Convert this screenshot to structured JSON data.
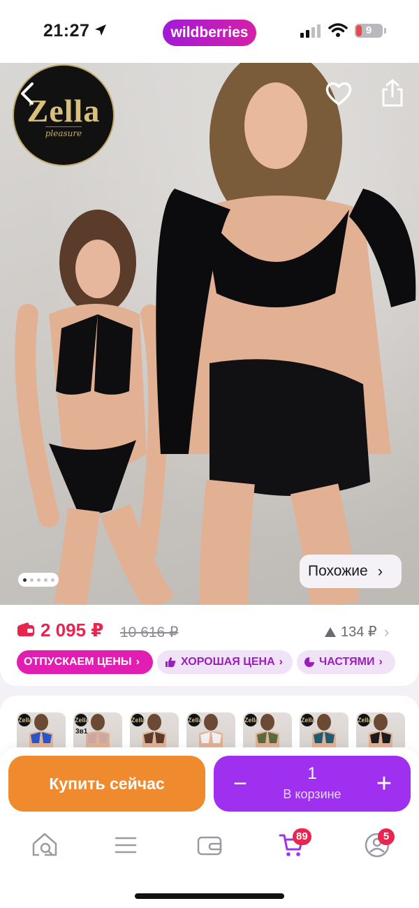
{
  "status_bar": {
    "time": "21:27",
    "brand": "wildberries",
    "battery": "9"
  },
  "hero": {
    "logo_name": "Zella",
    "logo_sub": "pleasure",
    "similar_label": "Похожие",
    "similar_chevron": "›",
    "gallery_dots": 5,
    "gallery_active": 1
  },
  "price": {
    "current": "2 095 ₽",
    "old": "10 616 ₽",
    "delta": "134 ₽",
    "delta_chevron": "›"
  },
  "tags": {
    "release": "ОТПУСКАЕМ ЦЕНЫ",
    "good": "ХОРОШАЯ ЦЕНА",
    "parts": "ЧАСТЯМИ",
    "chevron": "›"
  },
  "variants": [
    {
      "badge": "Zella",
      "color": "#2b56c8"
    },
    {
      "badge": "Zella",
      "color": "#c9a9a6",
      "note": "3в1"
    },
    {
      "badge": "Zella",
      "color": "#5a3a2a"
    },
    {
      "badge": "Zella",
      "color": "#f0eeee"
    },
    {
      "badge": "Zella",
      "color": "#5b6a3d"
    },
    {
      "badge": "Zella",
      "color": "#1f5c73"
    },
    {
      "badge": "Zella",
      "color": "#1c1c1c"
    }
  ],
  "actions": {
    "buy_now": "Купить сейчас",
    "qty": "1",
    "in_cart": "В корзине",
    "minus": "−",
    "plus": "+"
  },
  "tabbar": {
    "cart_badge": "89",
    "profile_badge": "5"
  },
  "colors": {
    "brand_gradient_start": "#a11bd6",
    "brand_gradient_end": "#d61fa8",
    "price_red": "#e8254e",
    "buy_orange": "#f08a2e",
    "cart_purple": "#a030f0",
    "tag_pink": "#e21db2"
  }
}
